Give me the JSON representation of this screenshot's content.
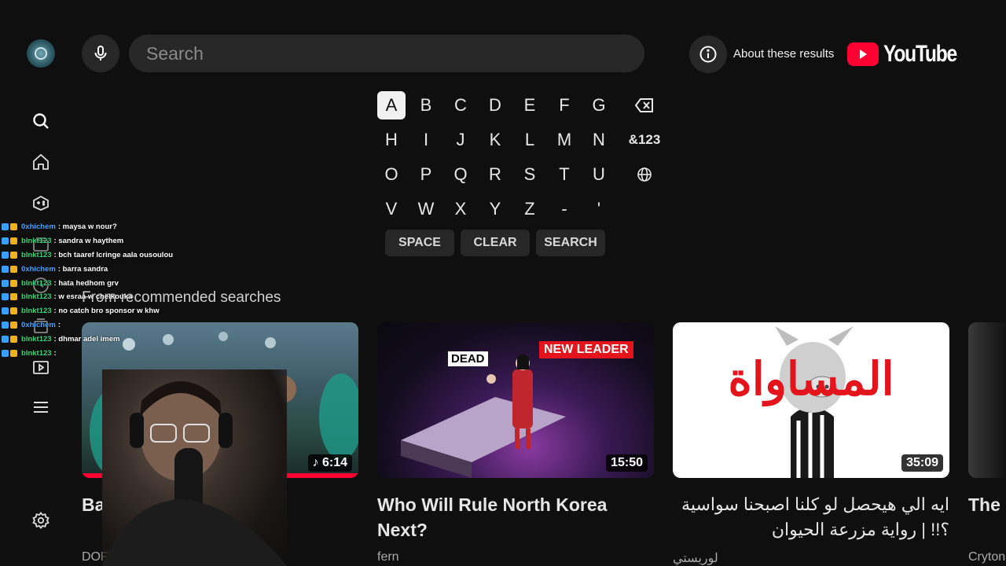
{
  "search": {
    "placeholder": "Search"
  },
  "header": {
    "about": "About these results",
    "logo_text": "YouTube"
  },
  "keyboard": {
    "rows": [
      [
        "A",
        "B",
        "C",
        "D",
        "E",
        "F",
        "G"
      ],
      [
        "H",
        "I",
        "J",
        "K",
        "L",
        "M",
        "N"
      ],
      [
        "O",
        "P",
        "Q",
        "R",
        "S",
        "T",
        "U"
      ],
      [
        "V",
        "W",
        "X",
        "Y",
        "Z",
        "-",
        "'"
      ]
    ],
    "symbols_label": "&123",
    "selected": "A",
    "actions": {
      "space": "SPACE",
      "clear": "CLEAR",
      "search": "SEARCH"
    }
  },
  "section_title": "From recommended searches",
  "cards": [
    {
      "title": "Band... Kofs / Jul... /",
      "channel": "DOF",
      "duration": "6:14"
    },
    {
      "title": "Who Will Rule North Korea Next?",
      "channel": "fern",
      "duration": "15:50",
      "tag_dead": "DEAD",
      "tag_leader": "NEW LEADER"
    },
    {
      "title": "ايه الي هيحصل لو كلنا اصبحنا سواسية ؟!! | رواية مزرعة الحيوان",
      "channel": "لوريستي",
      "duration": "35:09",
      "thumb_text": "المساواة"
    },
    {
      "title": "The Most",
      "channel": "Cryton"
    }
  ],
  "chat": [
    {
      "user": "0xhichem",
      "msg": ": maysa w nour?",
      "color": "#4aa3ff"
    },
    {
      "user": "blnkt123",
      "msg": ": sandra w haythem",
      "color": "#3ad17a"
    },
    {
      "user": "blnkt123",
      "msg": ": bch taaref lcringe aala ousoulou",
      "color": "#3ad17a"
    },
    {
      "user": "0xhichem",
      "msg": ": barra sandra",
      "color": "#4aa3ff"
    },
    {
      "user": "blnkt123",
      "msg": ": hata hedhom grv",
      "color": "#3ad17a"
    },
    {
      "user": "blnkt123",
      "msg": ": w esraa w cheikouka",
      "color": "#3ad17a"
    },
    {
      "user": "blnkt123",
      "msg": ": no catch bro sponsor w khw",
      "color": "#3ad17a"
    },
    {
      "user": "0xhichem",
      "msg": ":",
      "color": "#4aa3ff"
    },
    {
      "user": "blnkt123",
      "msg": ": dhmar adel imem",
      "color": "#3ad17a"
    },
    {
      "user": "blnkt123",
      "msg": ":",
      "color": "#3ad17a"
    }
  ],
  "colors": {
    "accent": "#ff0033",
    "background": "#0f0f0f",
    "surface": "#272727"
  }
}
